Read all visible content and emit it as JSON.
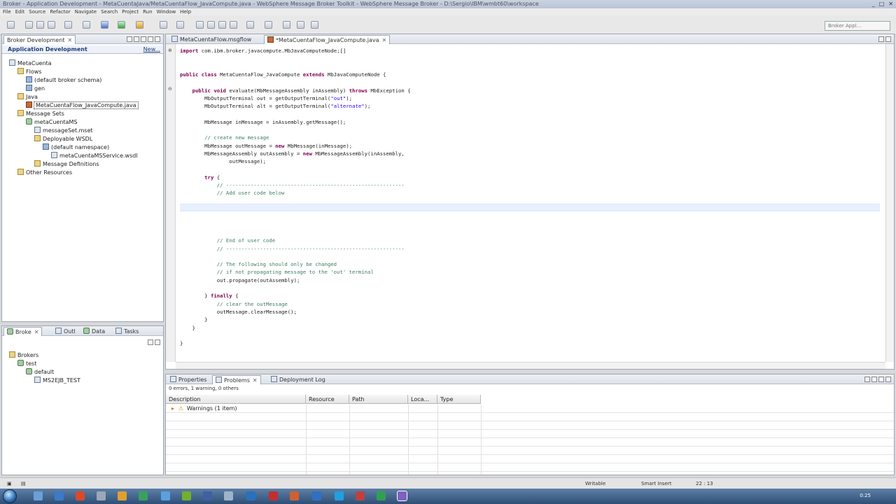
{
  "window": {
    "title": "Broker - Application Development - MetaCuentaJava/MetaCuentaFlow_JavaCompute.java - WebSphere Message Broker Toolkit - WebSphere Message Broker - D:\\Sergio\\IBM\\wmbt60\\workspace",
    "minimize": "_",
    "maximize": "□",
    "close": "✕"
  },
  "menu": [
    "File",
    "Edit",
    "Source",
    "Refactor",
    "Navigate",
    "Search",
    "Project",
    "Run",
    "Window",
    "Help"
  ],
  "toolbar": {
    "perspective": "Broker Appl..."
  },
  "left_panel": {
    "tab": "Broker Development",
    "section": "Application Development",
    "new_link": "New...",
    "tree": [
      {
        "label": "MetaCuenta",
        "icon": "project-icon",
        "indent": 0
      },
      {
        "label": "Flows",
        "icon": "folder-icon",
        "indent": 1
      },
      {
        "label": "(default broker schema)",
        "icon": "package-icon",
        "indent": 2
      },
      {
        "label": "gen",
        "icon": "package-icon",
        "indent": 2
      },
      {
        "label": "Java",
        "icon": "folder-icon",
        "indent": 1
      },
      {
        "label": "MetaCuentaFlow_JavaCompute.java",
        "icon": "java-file-icon",
        "indent": 2,
        "selected": true
      },
      {
        "label": "Message Sets",
        "icon": "folder-icon",
        "indent": 1
      },
      {
        "label": "metaCuentaMS",
        "icon": "message-set-icon",
        "indent": 2
      },
      {
        "label": "messageSet.mset",
        "icon": "file-icon",
        "indent": 3
      },
      {
        "label": "Deployable WSDL",
        "icon": "folder-icon",
        "indent": 3
      },
      {
        "label": "(default namespace)",
        "icon": "package-icon",
        "indent": 4
      },
      {
        "label": "metaCuentaMSService.wsdl",
        "icon": "file-icon",
        "indent": 5
      },
      {
        "label": "Message Definitions",
        "icon": "folder-icon",
        "indent": 3
      },
      {
        "label": "Other Resources",
        "icon": "folder-icon",
        "indent": 1
      }
    ]
  },
  "bottom_left_panel": {
    "tabs": [
      "Broke",
      "Outl",
      "Data",
      "Tasks"
    ],
    "tree": [
      {
        "label": "Brokers",
        "icon": "folder-icon",
        "indent": 0
      },
      {
        "label": "test",
        "icon": "broker-icon",
        "indent": 1
      },
      {
        "label": "default",
        "icon": "execution-group-icon",
        "indent": 2
      },
      {
        "label": "MS2EJB_TEST",
        "icon": "flow-icon",
        "indent": 3
      }
    ]
  },
  "editor": {
    "tabs": [
      "MetaCuentaFlow.msgflow",
      "*MetaCuentaFlow_JavaCompute.java"
    ],
    "lines": [
      "import com.ibm.broker.javacompute.MbJavaComputeNode;[]",
      "",
      "",
      "public class MetaCuentaFlow_JavaCompute extends MbJavaComputeNode {",
      "",
      "    public void evaluate(MbMessageAssembly inAssembly) throws MbException {",
      "        MbOutputTerminal out = getOutputTerminal(\"out\");",
      "        MbOutputTerminal alt = getOutputTerminal(\"alternate\");",
      "",
      "        MbMessage inMessage = inAssembly.getMessage();",
      "",
      "        // create new message",
      "        MbMessage outMessage = new MbMessage(inMessage);",
      "        MbMessageAssembly outAssembly = new MbMessageAssembly(inAssembly,",
      "                outMessage);",
      "",
      "        try {",
      "            // ----------------------------------------------------------",
      "            // Add user code below",
      "",
      "",
      "",
      "",
      "",
      "            // End of user code",
      "            // ----------------------------------------------------------",
      "",
      "            // The following should only be changed",
      "            // if not propagating message to the 'out' terminal",
      "            out.propagate(outAssembly);",
      "",
      "        } finally {",
      "            // clear the outMessage",
      "            outMessage.clearMessage();",
      "        }",
      "    }",
      "",
      "}"
    ]
  },
  "problems_panel": {
    "tabs": [
      "Properties",
      "Problems",
      "Deployment Log"
    ],
    "summary": "0 errors, 1 warning, 0 others",
    "columns": [
      "Description",
      "Resource",
      "Path",
      "Loca...",
      "Type"
    ],
    "rows": [
      {
        "description": "Warnings (1 item)"
      }
    ]
  },
  "status_bar": {
    "mode": "Writable",
    "insert": "Smart Insert",
    "position": "22 : 13"
  },
  "taskbar": {
    "clock": "0:25"
  }
}
